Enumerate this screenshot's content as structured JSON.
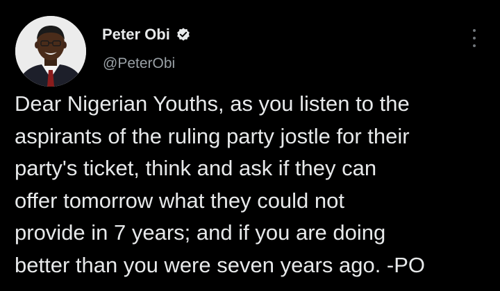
{
  "author": {
    "display_name": "Peter Obi",
    "handle": "@PeterObi",
    "verified_icon": "verified-badge-icon",
    "avatar_icon": "profile-avatar"
  },
  "menu": {
    "icon": "more-options-icon"
  },
  "tweet": {
    "lines": [
      "Dear Nigerian Youths, as you listen to the",
      "aspirants of the ruling party jostle for their",
      "party's ticket, think and ask if they can",
      "offer tomorrow what they could not",
      "provide in 7 years; and if you are doing",
      "better than you were seven years ago. -PO"
    ]
  },
  "colors": {
    "background": "#000000",
    "text": "#e7e9ea",
    "secondary_text": "#71767b"
  }
}
